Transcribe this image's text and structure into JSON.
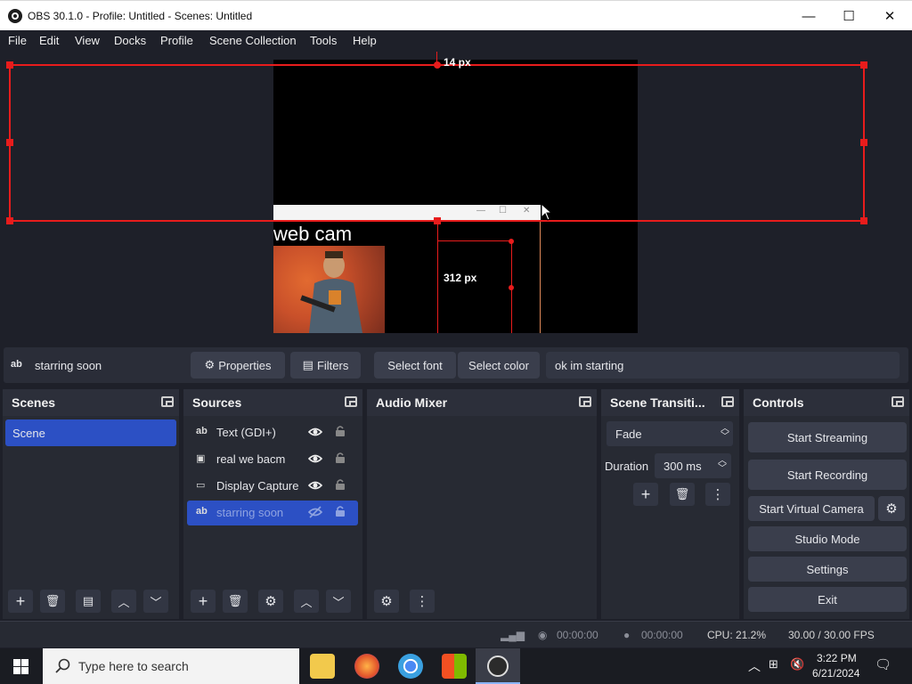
{
  "window": {
    "title": "OBS 30.1.0 - Profile: Untitled - Scenes: Untitled",
    "min": "—",
    "max": "☐",
    "close": "✕"
  },
  "menu": [
    "File",
    "Edit",
    "View",
    "Docks",
    "Profile",
    "Scene Collection",
    "Tools",
    "Help"
  ],
  "preview": {
    "top_px_label": "14 px",
    "height_px_label": "312 px",
    "webcam_label": "web cam",
    "inner_window_buttons": [
      "—",
      "☐",
      "✕"
    ]
  },
  "source_toolbar": {
    "source_name": "starring soon",
    "properties": "Properties",
    "filters": "Filters",
    "select_font": "Select font",
    "select_color": "Select color",
    "text_value": "ok im starting"
  },
  "scenes": {
    "title": "Scenes",
    "items": [
      "Scene"
    ]
  },
  "sources": {
    "title": "Sources",
    "items": [
      {
        "label": "Text (GDI+)",
        "icon": "text-icon"
      },
      {
        "label": "real we bacm",
        "icon": "image-icon"
      },
      {
        "label": "Display Capture",
        "icon": "monitor-icon"
      },
      {
        "label": "starring soon",
        "icon": "text-icon",
        "selected": true,
        "hidden": true
      }
    ]
  },
  "audio_mixer": {
    "title": "Audio Mixer"
  },
  "transitions": {
    "title": "Scene Transiti...",
    "selected": "Fade",
    "duration_label": "Duration",
    "duration_value": "300 ms"
  },
  "controls": {
    "title": "Controls",
    "start_streaming": "Start Streaming",
    "start_recording": "Start Recording",
    "start_virtual_camera": "Start Virtual Camera",
    "studio_mode": "Studio Mode",
    "settings": "Settings",
    "exit": "Exit"
  },
  "status": {
    "stream_time": "00:00:00",
    "record_time": "00:00:00",
    "cpu": "CPU: 21.2%",
    "fps": "30.00 / 30.00 FPS"
  },
  "taskbar": {
    "search_placeholder": "Type here to search",
    "time": "3:22 PM",
    "date": "6/21/2024"
  },
  "colors": {
    "accent": "#2c50c4",
    "selection_red": "#e81c1c",
    "panel": "#272a33",
    "background": "#1e2029"
  }
}
